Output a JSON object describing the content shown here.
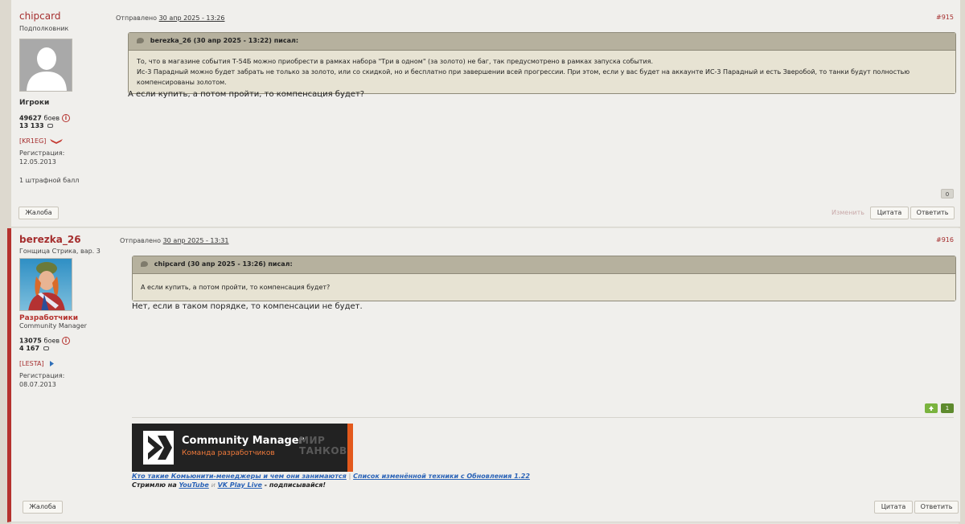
{
  "post1": {
    "author": {
      "name": "chipcard",
      "rank": "Подполковник",
      "group": "Игроки",
      "battles": "49627",
      "battles_label": "боев",
      "posts": "13 133",
      "clan": "[KR1EG]",
      "reg_label": "Регистрация:",
      "reg_date": "12.05.2013",
      "warning": "1 штрафной балл"
    },
    "meta": {
      "sent_label": "Отправлено",
      "date": "30 апр 2025 - 13:26"
    },
    "number": "#915",
    "quote": {
      "header": "berezka_26 (30 апр 2025 - 13:22) писал:",
      "line1": "То, что в магазине события Т-54Б можно приобрести в рамках набора \"Три в одном\" (за золото) не баг, так предусмотрено в рамках запуска события.",
      "line2": "Ис-3 Парадный можно будет забрать не только за золото, или со скидкой, но и бесплатно при завершении всей прогрессии. При этом, если у вас будет на аккаунте ИС-3 Парадный и есть Зверобой, то танки будут полностью компенсированы золотом."
    },
    "reply": "А если купить, а потом пройти, то компенсация будет?",
    "reputation": "0",
    "buttons": {
      "report": "Жалоба",
      "edit": "Изменить",
      "quote": "Цитата",
      "answer": "Ответить"
    }
  },
  "post2": {
    "author": {
      "name": "berezka_26",
      "rank": "Гонщица Стрика, вар. 3",
      "group": "Разработчики",
      "subgroup": "Community Manager",
      "battles": "13075",
      "battles_label": "боев",
      "posts": "4 167",
      "clan": "[LESTA]",
      "reg_label": "Регистрация:",
      "reg_date": "08.07.2013"
    },
    "meta": {
      "sent_label": "Отправлено",
      "date": "30 апр 2025 - 13:31"
    },
    "number": "#916",
    "quote": {
      "header": "chipcard (30 апр 2025 - 13:26) писал:",
      "line1": "А если купить, а потом пройти, то компенсация будет?"
    },
    "reply": "Нет, если в таком порядке, то компенсации не будет.",
    "reputation": "1",
    "banner": {
      "title": "Community Manager",
      "subtitle": "Команда разработчиков",
      "brand_line1": "МИР",
      "brand_line2": "ТАНКОВ"
    },
    "signature": {
      "link1": "Кто такие Комьюнити-менеджеры и чем они занимаются",
      "separator": "|",
      "link2": "Список изменённой техники с Обновления 1.22",
      "stream_prefix": "Стримлю на",
      "youtube": "YouTube",
      "and": "и",
      "vk": "VK Play Live",
      "stream_suffix": "- подписывайся!"
    },
    "buttons": {
      "report": "Жалоба",
      "quote": "Цитата",
      "answer": "Ответить"
    }
  },
  "colors": {
    "accent": "#a52e2e",
    "dev_stripe": "#b5322e",
    "quote_bg": "#d9d5c4",
    "link": "#2a63b7"
  }
}
